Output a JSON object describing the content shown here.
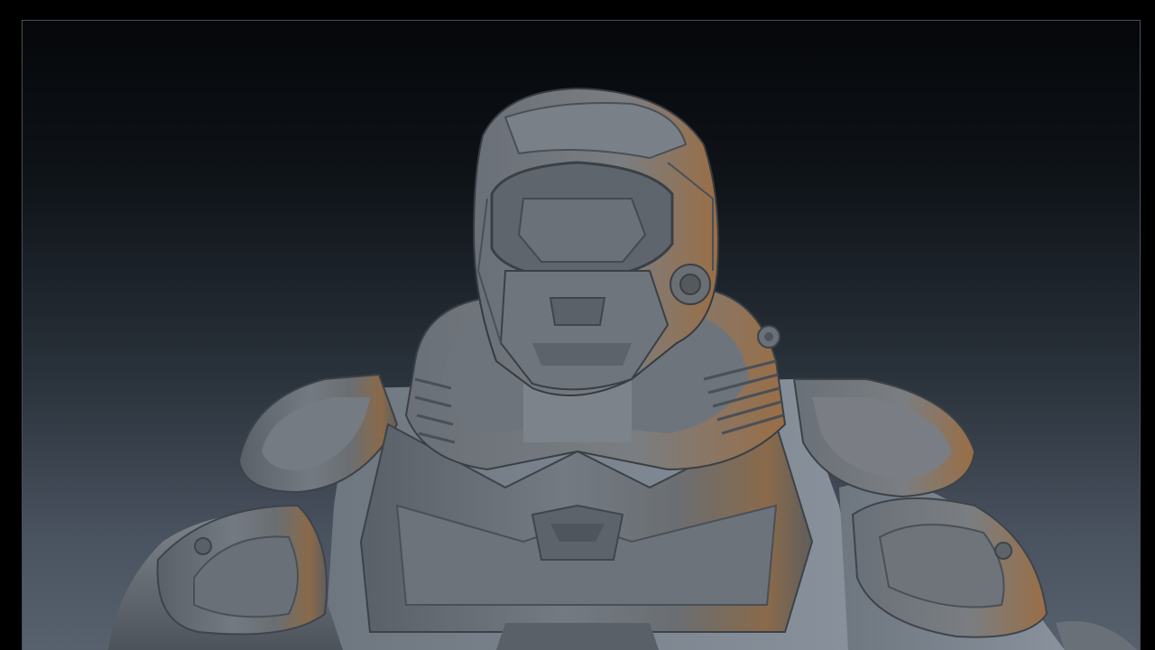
{
  "viewport": {
    "icon": "sculpt-model-icon"
  }
}
